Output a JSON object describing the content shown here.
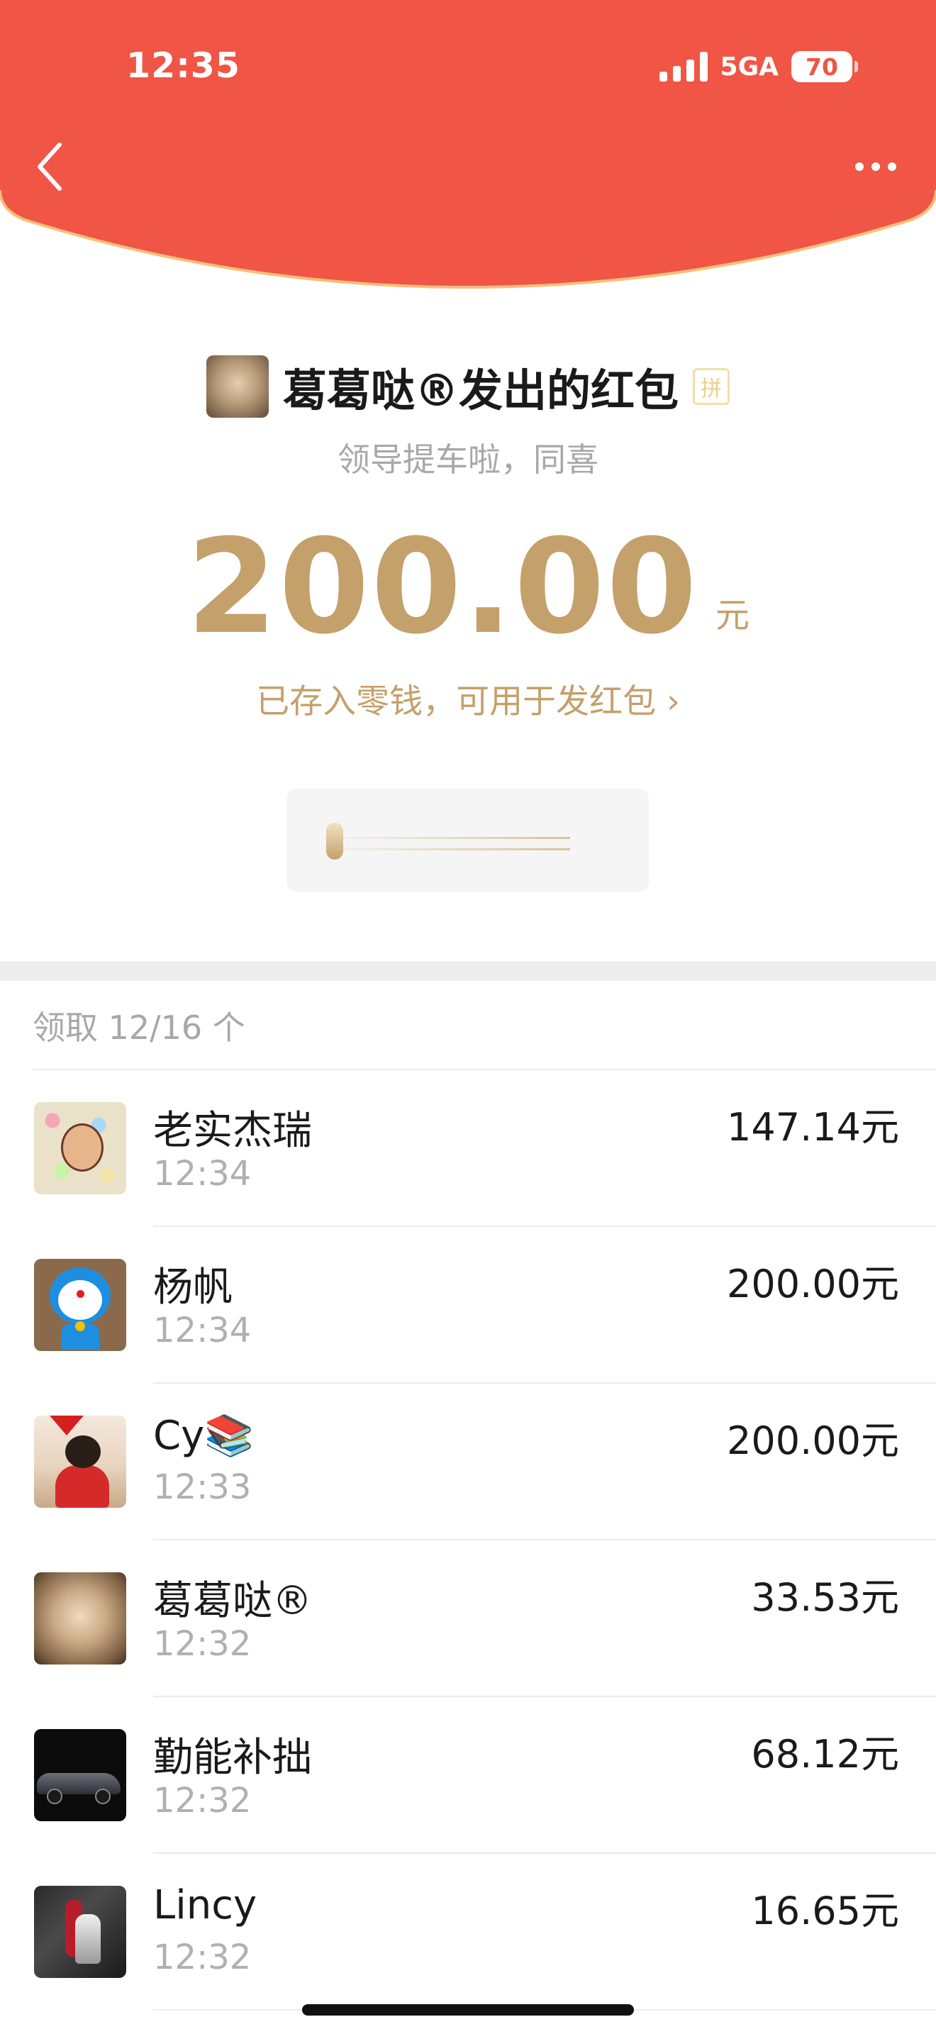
{
  "status_bar": {
    "time": "12:35",
    "network": "5GA",
    "battery": "70",
    "icons": [
      "cellular-signal-icon",
      "battery-icon"
    ]
  },
  "nav": {
    "icons": [
      "back-chevron-icon",
      "more-dots-icon"
    ]
  },
  "colors": {
    "header_red": "#F05545",
    "header_edge": "#F5C07A",
    "gold": "#C4A06B",
    "muted_text": "#A8A8A8"
  },
  "envelope": {
    "title": "葛葛哒®发出的红包",
    "pin_badge": "拼",
    "greeting": "领导提车啦，同喜",
    "amount": "200.00",
    "unit": "元",
    "saved_link": "已存入零钱，可用于发红包 ›"
  },
  "claims": {
    "header": "领取 12/16 个",
    "rows": [
      {
        "name": "老实杰瑞",
        "time": "12:34",
        "amount": "147.14元",
        "avatar_icon": "cartoon-pattern-avatar"
      },
      {
        "name": "杨帆",
        "time": "12:34",
        "amount": "200.00元",
        "avatar_icon": "doraemon-avatar"
      },
      {
        "name": "Cy📚",
        "time": "12:33",
        "amount": "200.00元",
        "avatar_icon": "dog-in-red-outfit-avatar"
      },
      {
        "name": "葛葛哒®",
        "time": "12:32",
        "amount": "33.53元",
        "avatar_icon": "cat-avatar"
      },
      {
        "name": "勤能补拙",
        "time": "12:32",
        "amount": "68.12元",
        "avatar_icon": "car-avatar"
      },
      {
        "name": "Lincy",
        "time": "12:32",
        "amount": "16.65元",
        "avatar_icon": "car-ornament-avatar"
      }
    ]
  }
}
